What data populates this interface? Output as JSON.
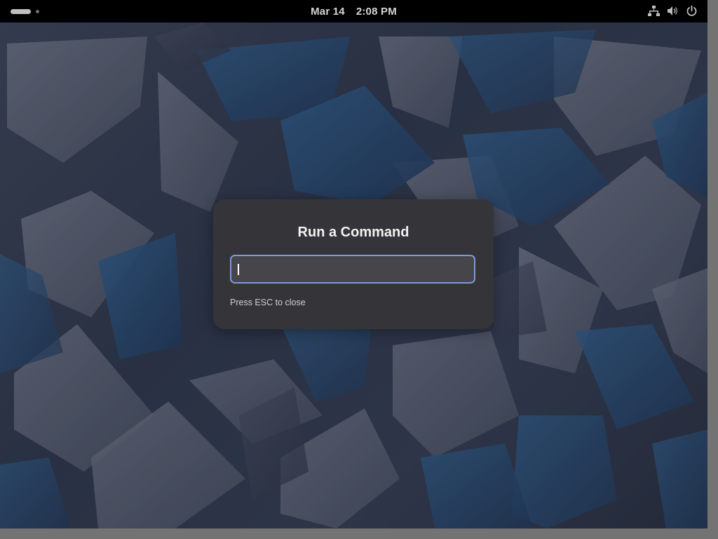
{
  "topbar": {
    "date": "Mar 14",
    "time": "2:08 PM",
    "activities_icon": "workspace-indicator",
    "tray_icons": [
      "network-icon",
      "volume-icon",
      "power-icon"
    ]
  },
  "dialog": {
    "title": "Run a Command",
    "input_value": "",
    "input_placeholder": "",
    "hint": "Press ESC to close"
  },
  "colors": {
    "topbar_bg": "#000000",
    "dialog_bg": "#353539",
    "input_bg": "#45454a",
    "focus_border": "#7b9bd6",
    "desktop_border": "#737373"
  }
}
